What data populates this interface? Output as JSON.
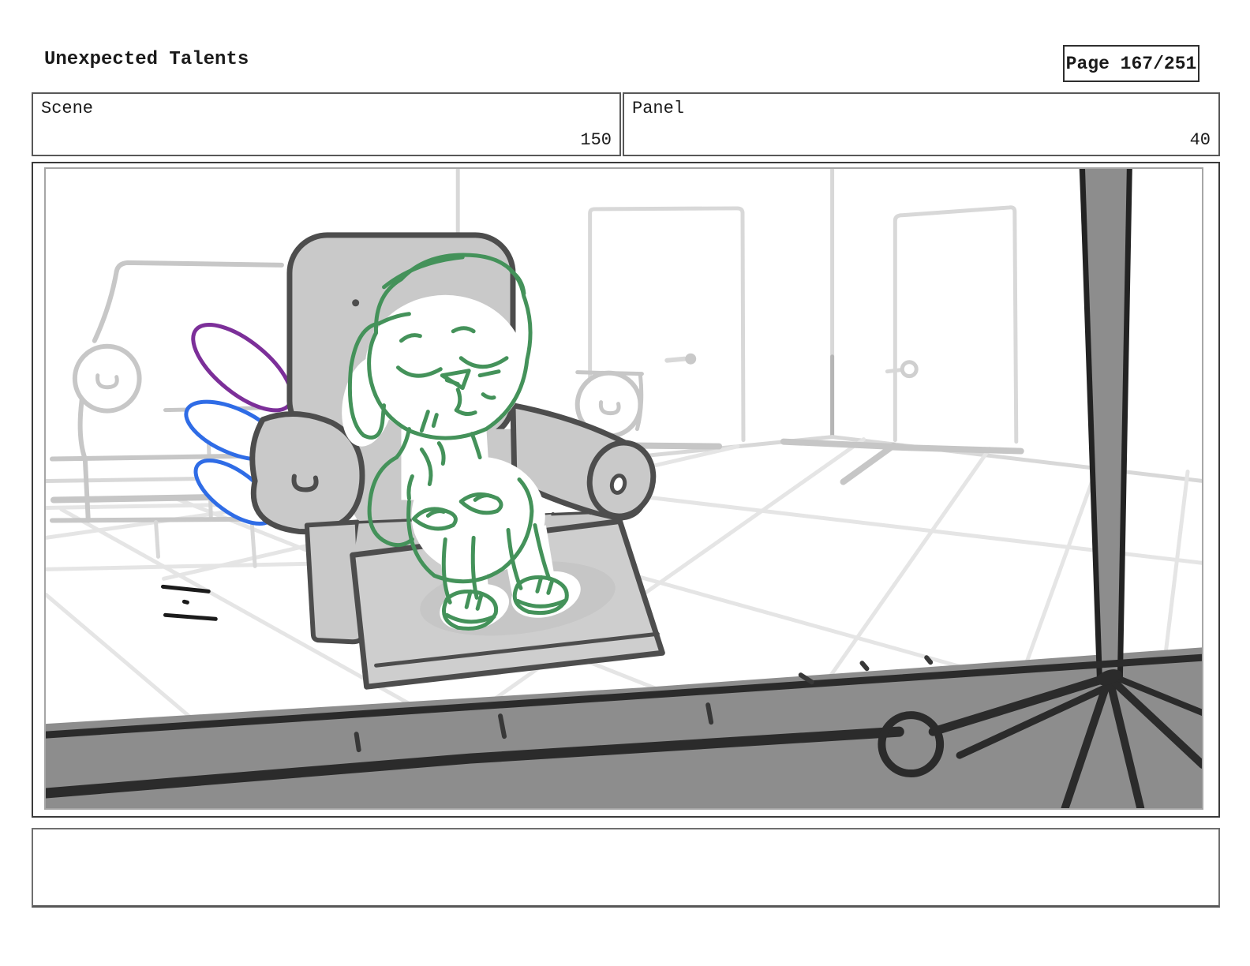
{
  "header": {
    "title": "Unexpected Talents",
    "page_label": "Page 167/251"
  },
  "scene": {
    "label": "Scene",
    "value": "150"
  },
  "panel": {
    "label": "Panel",
    "value": "40"
  },
  "notes": {
    "value": ""
  },
  "drawing": {
    "colors": {
      "character_green": "#44925a",
      "wing_purple": "#7c2f99",
      "wing_blue": "#2f6ce6",
      "chair_fill": "#c9c9c9",
      "chair_outline": "#4d4d4d",
      "footrest_fill": "#cecece",
      "couch_line": "#c7c7c7",
      "wall_line": "#d8d8d8",
      "floor_line": "#e5e5e5",
      "floor_shadow": "#c6c6c6",
      "foreground_fill": "#8d8d8d",
      "foreground_dark": "#2b2b2b",
      "pole_edge": "#232323",
      "ink_black": "#1b1b1b"
    }
  }
}
